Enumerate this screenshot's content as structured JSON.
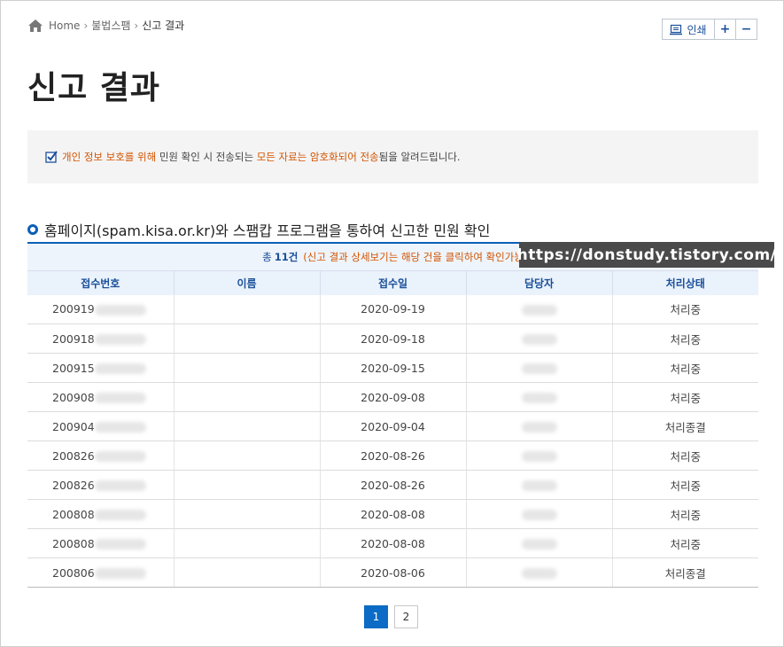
{
  "breadcrumb": {
    "home": "Home",
    "level1": "불법스팸",
    "current": "신고 결과"
  },
  "toolbar": {
    "print_label": "인쇄",
    "zoom_in_label": "+",
    "zoom_out_label": "−"
  },
  "page_title": "신고 결과",
  "notice": {
    "part1": "개인 정보 보호를 위해",
    "part2": " 민원 확인 시 전송되는 ",
    "part3": "모든 자료는 암호화되어 전송",
    "part4": "됨을 알려드립니다."
  },
  "section_title": "홈페이지(spam.kisa.or.kr)와 스팸캅 프로그램을 통하여 신고한 민원 확인",
  "summary": {
    "prefix": "총",
    "count": "11건",
    "hint": "(신고 결과 상세보기는 해당 건을 클릭하여 확인가능"
  },
  "watermark": "https://donstudy.tistory.com/",
  "table": {
    "headers": [
      "접수번호",
      "이름",
      "접수일",
      "담당자",
      "처리상태"
    ],
    "rows": [
      {
        "id": "200919",
        "date": "2020-09-19",
        "status": "처리중"
      },
      {
        "id": "200918",
        "date": "2020-09-18",
        "status": "처리중"
      },
      {
        "id": "200915",
        "date": "2020-09-15",
        "status": "처리중"
      },
      {
        "id": "200908",
        "date": "2020-09-08",
        "status": "처리중"
      },
      {
        "id": "200904",
        "date": "2020-09-04",
        "status": "처리종결"
      },
      {
        "id": "200826",
        "date": "2020-08-26",
        "status": "처리중"
      },
      {
        "id": "200826",
        "date": "2020-08-26",
        "status": "처리중"
      },
      {
        "id": "200808",
        "date": "2020-08-08",
        "status": "처리중"
      },
      {
        "id": "200808",
        "date": "2020-08-08",
        "status": "처리중"
      },
      {
        "id": "200806",
        "date": "2020-08-06",
        "status": "처리종결"
      }
    ]
  },
  "pagination": {
    "pages": [
      "1",
      "2"
    ],
    "current": "1"
  },
  "colors": {
    "accent": "#0b5fb5",
    "highlight": "#d35400",
    "header_bg": "#eaf2fb"
  }
}
